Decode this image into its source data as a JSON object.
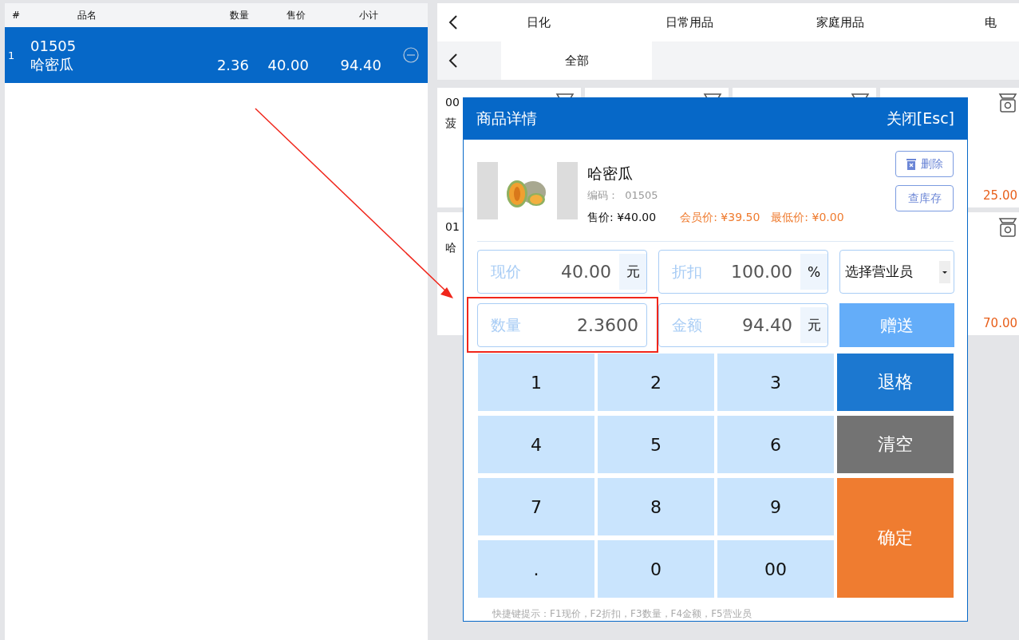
{
  "order_table": {
    "columns": [
      "#",
      "品名",
      "数量",
      "售价",
      "小计"
    ],
    "rows": [
      {
        "index": "1",
        "code": "01505",
        "name": "哈密瓜",
        "qty": "2.36",
        "price": "40.00",
        "subtotal": "94.40",
        "selected": true
      }
    ]
  },
  "category_tabs": [
    "日化",
    "日常用品",
    "家庭用品",
    "电"
  ],
  "sub_tabs": [
    {
      "label": "全部",
      "selected": true
    }
  ],
  "product_cards": [
    {
      "code": "00",
      "name": "菠",
      "kind": "weighed"
    },
    {
      "kind": "weighed"
    },
    {
      "kind": "weighed"
    },
    {
      "price": "25.00",
      "kind": "weighed"
    },
    {
      "code": "01",
      "name": "哈",
      "kind": "plain"
    },
    {
      "kind": "covered"
    },
    {
      "kind": "covered"
    },
    {
      "price": "70.00",
      "kind": "weighed"
    }
  ],
  "dialog": {
    "title": "商品详情",
    "close": "关闭[Esc]",
    "product": {
      "name": "哈密瓜",
      "code_label": "编码：",
      "code": "01505",
      "sale_price": "售价: ¥40.00",
      "member_price": "会员价: ¥39.50",
      "min_price": "最低价: ¥0.00"
    },
    "actions": [
      {
        "label": "删除",
        "kind": "delete"
      },
      {
        "label": "查库存",
        "kind": "stock"
      }
    ],
    "fields": [
      {
        "label": "现价",
        "value": "40.00",
        "unit": "元",
        "highlighted": false
      },
      {
        "label": "折扣",
        "value": "100.00",
        "unit": "%",
        "highlighted": false
      },
      {
        "label": "数量",
        "value": "2.3600",
        "highlighted": true
      },
      {
        "label": "金额",
        "value": "94.40",
        "unit": "元",
        "highlighted": false
      }
    ],
    "salesperson": {
      "placeholder": "选择营业员"
    },
    "gift_button": "赠送",
    "digits": [
      "1",
      "2",
      "3",
      "4",
      "5",
      "6",
      "7",
      "8",
      "9",
      ".",
      "0",
      "00"
    ],
    "function_keys": [
      {
        "label": "退格",
        "kind": "backspace"
      },
      {
        "label": "清空",
        "kind": "clear"
      },
      {
        "label": "确定",
        "kind": "confirm"
      }
    ],
    "hint": "快捷键提示：F1现价，F2折扣，F3数量，F4金额，F5营业员"
  }
}
